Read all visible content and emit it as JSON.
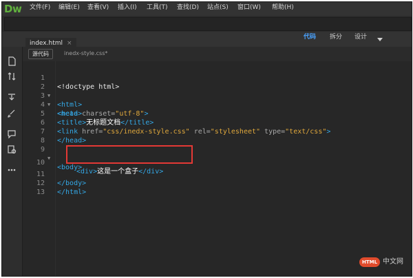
{
  "app": {
    "logo": "Dw"
  },
  "menu": [
    "文件(F)",
    "编辑(E)",
    "查看(V)",
    "插入(I)",
    "工具(T)",
    "查找(D)",
    "站点(S)",
    "窗口(W)",
    "帮助(H)"
  ],
  "views": {
    "code": "代码",
    "split": "拆分",
    "design": "设计"
  },
  "tabs": {
    "file": "index.html",
    "close": "×"
  },
  "subbar": {
    "source_button": "源代码",
    "related_file": "inedx-style.css*"
  },
  "editor": {
    "line_numbers": [
      "1",
      "2",
      "3",
      "4",
      "5",
      "6",
      "7",
      "8",
      "9",
      "10",
      "11",
      "12",
      "13"
    ],
    "lines": {
      "l1": "<!doctype html>",
      "l2_tag": "<html>",
      "l3_tag": "<head>",
      "l4_tag_open": "<meta",
      "l4_attr": " charset=",
      "l4_val": "\"utf-8\"",
      "l4_tag_close": ">",
      "l5_open": "<title>",
      "l5_text": "无标题文档",
      "l5_close": "</title>",
      "l6_tag_open": "<link",
      "l6_attr1": " href=",
      "l6_val1": "\"css/inedx-style.css\"",
      "l6_attr2": " rel=",
      "l6_val2": "\"stylesheet\"",
      "l6_attr3": " type=",
      "l6_val3": "\"text/css\"",
      "l6_tag_close": ">",
      "l7_tag": "</head>",
      "l9_tag": "<body>",
      "l10_open": "<div>",
      "l10_text": "这是一个盒子",
      "l10_close": "</div>",
      "l11_tag": "</body>",
      "l12_tag": "</html>"
    }
  },
  "watermark": {
    "badge": "HTML",
    "text": "中文网"
  },
  "colors": {
    "tag": "#34a8e6",
    "string": "#e0a83c",
    "active_view": "#4aa3ff",
    "highlight": "#e53935",
    "logo": "#61b13e"
  }
}
